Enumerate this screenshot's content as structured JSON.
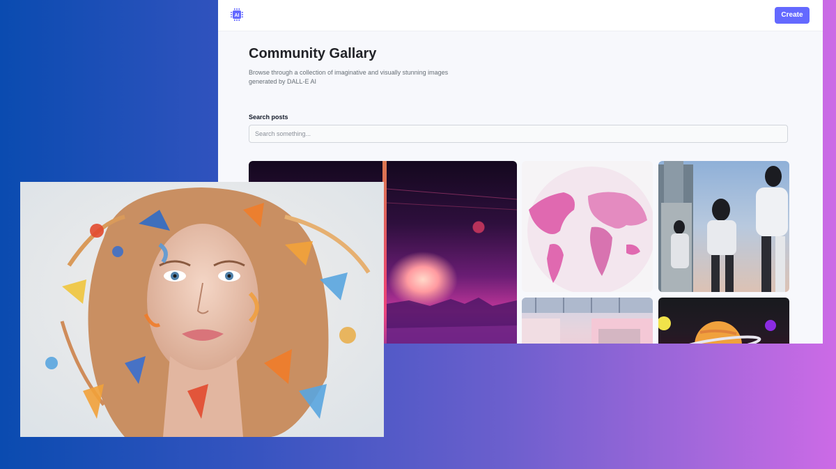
{
  "header": {
    "logo_text": "AI",
    "create_label": "Create"
  },
  "main": {
    "title": "Community Gallary",
    "subtitle": "Browse through a collection of imaginative and visually stunning images generated by DALL-E AI"
  },
  "search": {
    "label": "Search posts",
    "placeholder": "Search something...",
    "value": ""
  },
  "gallery": {
    "images": [
      {
        "name": "sunset-landscape-image",
        "description": "neon sunset over water"
      },
      {
        "name": "world-map-image",
        "description": "pink world globe map"
      },
      {
        "name": "robots-image",
        "description": "humanoid robots in city"
      },
      {
        "name": "building-image",
        "description": "pink architecture"
      },
      {
        "name": "planet-image",
        "description": "ringed planet in space"
      }
    ]
  },
  "colors": {
    "accent": "#6469ff",
    "page_bg": "#f7f8fc",
    "title": "#222328",
    "subtitle": "#666e75"
  }
}
